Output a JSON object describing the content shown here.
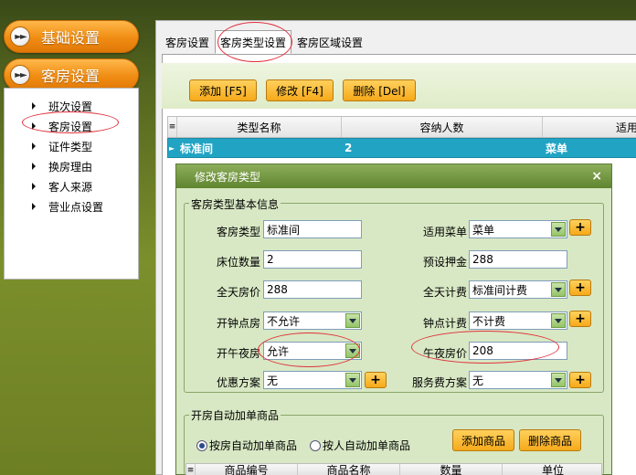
{
  "nav": {
    "groups": [
      {
        "label": "基础设置",
        "icon": "double-chevron-right-icon"
      },
      {
        "label": "客房设置",
        "icon": "double-chevron-right-icon"
      }
    ],
    "items": [
      "班次设置",
      "客房设置",
      "证件类型",
      "换房理由",
      "客人来源",
      "营业点设置"
    ]
  },
  "tabs": [
    "客房设置",
    "客房类型设置",
    "客房区域设置"
  ],
  "toolbar": {
    "add": "添加 [F5]",
    "edit": "修改 [F4]",
    "delete": "删除 [Del]"
  },
  "grid": {
    "headers": [
      "类型名称",
      "容纳人数",
      "适用菜"
    ],
    "row": [
      "标准间",
      "2",
      "菜单"
    ]
  },
  "dialog": {
    "title": "修改客房类型",
    "close": "×",
    "basic_legend": "客房类型基本信息",
    "fields": {
      "room_type": {
        "label": "客房类型",
        "value": "标准间"
      },
      "menu": {
        "label": "适用菜单",
        "value": "菜单"
      },
      "beds": {
        "label": "床位数量",
        "value": "2"
      },
      "deposit": {
        "label": "预设押金",
        "value": "288"
      },
      "day_price": {
        "label": "全天房价",
        "value": "288"
      },
      "day_billing": {
        "label": "全天计费",
        "value": "标准间计费"
      },
      "hourly_open": {
        "label": "开钟点房",
        "value": "不允许"
      },
      "hourly_billing": {
        "label": "钟点计费",
        "value": "不计费"
      },
      "midnight_open": {
        "label": "开午夜房",
        "value": "允许"
      },
      "midnight_price": {
        "label": "午夜房价",
        "value": "208"
      },
      "discount": {
        "label": "优惠方案",
        "value": "无"
      },
      "service_fee": {
        "label": "服务费方案",
        "value": "无"
      }
    },
    "plus": "+",
    "goods_legend": "开房自动加单商品",
    "radio_by_room": "按房自动加单商品",
    "radio_by_person": "按人自动加单商品",
    "add_goods": "添加商品",
    "delete_goods": "删除商品",
    "goods_headers": [
      "商品编号",
      "商品名称",
      "数量",
      "单位"
    ]
  }
}
